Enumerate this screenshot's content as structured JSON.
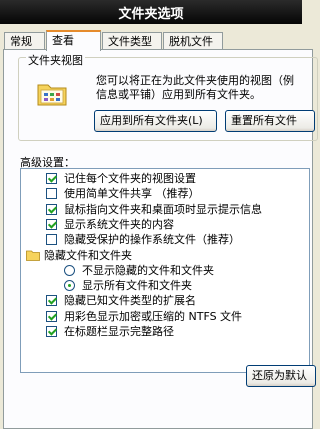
{
  "window": {
    "title": "文件夹选项"
  },
  "tabs": [
    "常规",
    "查看",
    "文件类型",
    "脱机文件"
  ],
  "active_tab": 1,
  "folder_views": {
    "label": "文件夹视图",
    "desc_line1": "您可以将正在为此文件夹使用的视图（例",
    "desc_line2": "信息或平铺）应用到所有文件夹。",
    "apply_all": "应用到所有文件夹(L)",
    "reset_all": "重置所有文件"
  },
  "advanced": {
    "label": "高级设置：",
    "items": [
      {
        "type": "checkbox",
        "checked": true,
        "indent": 1,
        "label": "记住每个文件夹的视图设置"
      },
      {
        "type": "checkbox",
        "checked": false,
        "indent": 1,
        "label": "使用简单文件共享 （推荐）"
      },
      {
        "type": "checkbox",
        "checked": true,
        "indent": 1,
        "label": "鼠标指向文件夹和桌面项时显示提示信息"
      },
      {
        "type": "checkbox",
        "checked": true,
        "indent": 1,
        "label": "显示系统文件夹的内容"
      },
      {
        "type": "checkbox",
        "checked": false,
        "indent": 1,
        "label": "隐藏受保护的操作系统文件（推荐）"
      },
      {
        "type": "folder",
        "checked": false,
        "indent": 0,
        "label": "隐藏文件和文件夹"
      },
      {
        "type": "radio",
        "checked": false,
        "indent": 2,
        "label": "不显示隐藏的文件和文件夹"
      },
      {
        "type": "radio",
        "checked": true,
        "indent": 2,
        "label": "显示所有文件和文件夹"
      },
      {
        "type": "checkbox",
        "checked": true,
        "indent": 1,
        "label": "隐藏已知文件类型的扩展名"
      },
      {
        "type": "checkbox",
        "checked": true,
        "indent": 1,
        "label": "用彩色显示加密或压缩的 NTFS 文件"
      },
      {
        "type": "checkbox",
        "checked": true,
        "indent": 1,
        "label": "在标题栏显示完整路径"
      }
    ],
    "restore_defaults": "还原为默认"
  }
}
